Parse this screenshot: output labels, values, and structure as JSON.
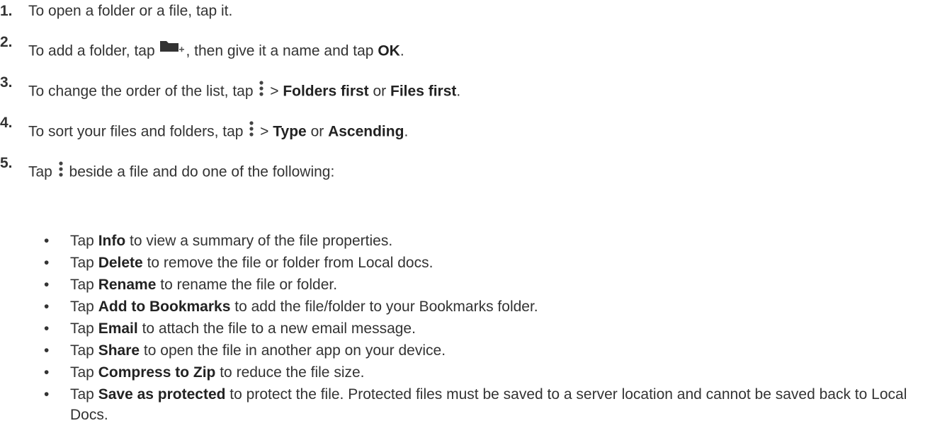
{
  "steps": [
    {
      "num": "1.",
      "a": "To open a folder or a file, tap it."
    },
    {
      "num": "2.",
      "a": "To add a folder, tap ",
      "icon": "folder-add-icon",
      "b": ", then give it a name and tap ",
      "bold1": "OK",
      "c": "."
    },
    {
      "num": "3.",
      "a": "To change the order of the list, tap ",
      "icon": "more-vert-icon",
      "b": " > ",
      "bold1": "Folders first",
      "c": " or ",
      "bold2": "Files first",
      "d": "."
    },
    {
      "num": "4.",
      "a": "To sort your files and folders, tap ",
      "icon": "more-vert-icon",
      "b": " > ",
      "bold1": "Type",
      "c": " or ",
      "bold2": "Ascending",
      "d": "."
    },
    {
      "num": "5.",
      "a": "Tap ",
      "icon": "more-vert-icon",
      "b": " beside a file and do one of the following:"
    }
  ],
  "bullet_char": "•",
  "sub_items": [
    {
      "pre": "Tap ",
      "bold": "Info",
      "post": " to view a summary of the file properties."
    },
    {
      "pre": "Tap ",
      "bold": "Delete",
      "post": " to remove the file or folder from Local docs."
    },
    {
      "pre": "Tap ",
      "bold": "Rename",
      "post": " to rename the file or folder."
    },
    {
      "pre": "Tap ",
      "bold": "Add to Bookmarks",
      "post": " to add the file/folder to your Bookmarks folder."
    },
    {
      "pre": "Tap ",
      "bold": "Email",
      "post": " to attach the file to a new email message."
    },
    {
      "pre": "Tap ",
      "bold": "Share",
      "post": " to open the file in another app on your device."
    },
    {
      "pre": "Tap ",
      "bold": "Compress to Zip",
      "post": " to reduce the file size."
    },
    {
      "pre": "Tap ",
      "bold": "Save as protected",
      "post": " to protect the file. Protected files must be saved to a server location and cannot be saved back to Local Docs."
    }
  ]
}
